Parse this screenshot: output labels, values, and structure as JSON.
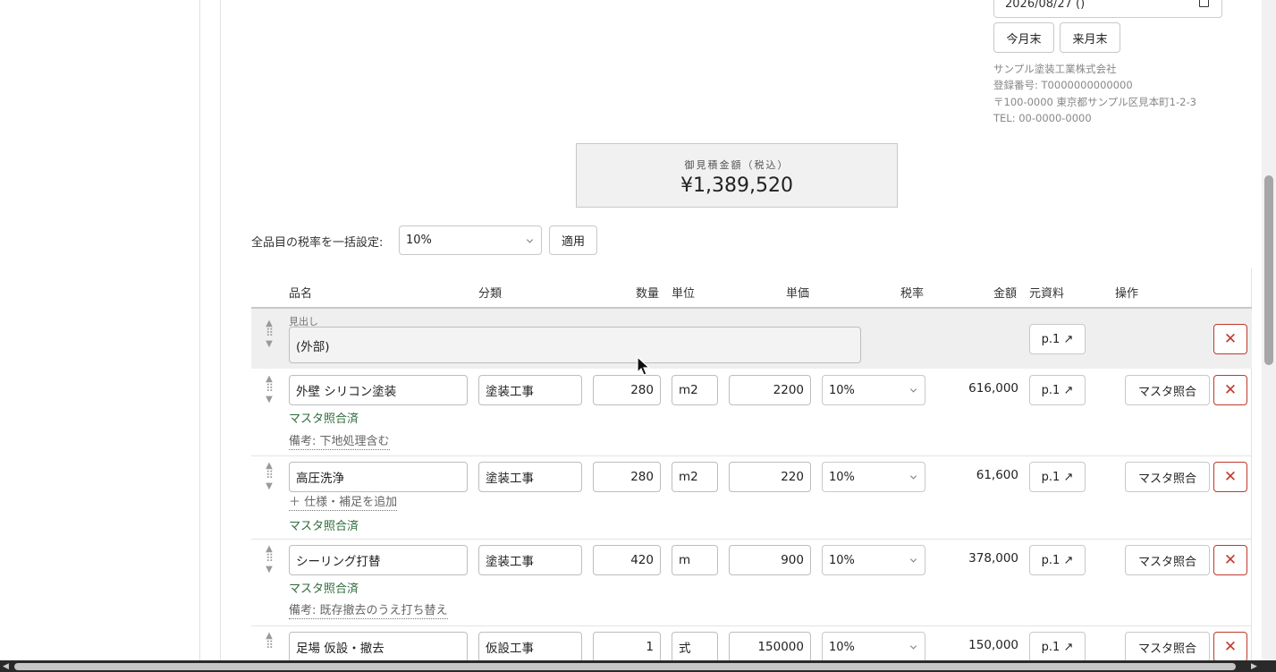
{
  "date_value": "2026/08/27 ()",
  "buttons": {
    "this_month_end": "今月末",
    "next_month_end": "来月末",
    "apply": "適用"
  },
  "company": {
    "name": "サンプル塗装工業株式会社",
    "reg_no": "登録番号: T0000000000000",
    "address": "〒100-0000 東京都サンプル区見本町1-2-3",
    "tel": "TEL: 00-0000-0000"
  },
  "total": {
    "label": "御見積金額（税込）",
    "amount": "¥1,389,520"
  },
  "bulk_tax": {
    "label": "全品目の税率を一括設定:",
    "value": "10%"
  },
  "columns": {
    "name": "品名",
    "category": "分類",
    "qty": "数量",
    "unit": "単位",
    "unit_price": "単価",
    "tax": "税率",
    "amount": "金額",
    "source": "元資料",
    "ops": "操作"
  },
  "heading_row": {
    "label": "見出し",
    "value": "(外部)",
    "source": "p.1 ↗"
  },
  "rows": [
    {
      "name": "外壁 シリコン塗装",
      "category": "塗装工事",
      "qty": "280",
      "unit": "m2",
      "price": "2200",
      "tax": "10%",
      "amount": "616,000",
      "source": "p.1 ↗",
      "match": "マスタ照合",
      "status": "マスタ照合済",
      "note": "備考: 下地処理含む"
    },
    {
      "name": "高圧洗浄",
      "category": "塗装工事",
      "qty": "280",
      "unit": "m2",
      "price": "220",
      "tax": "10%",
      "amount": "61,600",
      "source": "p.1 ↗",
      "match": "マスタ照合",
      "add_spec": "＋ 仕様・補足を追加",
      "status": "マスタ照合済"
    },
    {
      "name": "シーリング打替",
      "category": "塗装工事",
      "qty": "420",
      "unit": "m",
      "price": "900",
      "tax": "10%",
      "amount": "378,000",
      "source": "p.1 ↗",
      "match": "マスタ照合",
      "status": "マスタ照合済",
      "note": "備考: 既存撤去のうえ打ち替え"
    },
    {
      "name": "足場 仮設・撤去",
      "category": "仮設工事",
      "qty": "1",
      "unit": "式",
      "price": "150000",
      "tax": "10%",
      "amount": "150,000",
      "source": "p.1 ↗",
      "match": "マスタ照合"
    }
  ],
  "icons": {
    "delete": "close-icon",
    "drag": "drag-handle-icon",
    "calendar": "calendar-icon",
    "chevron": "chevron-down-icon"
  }
}
